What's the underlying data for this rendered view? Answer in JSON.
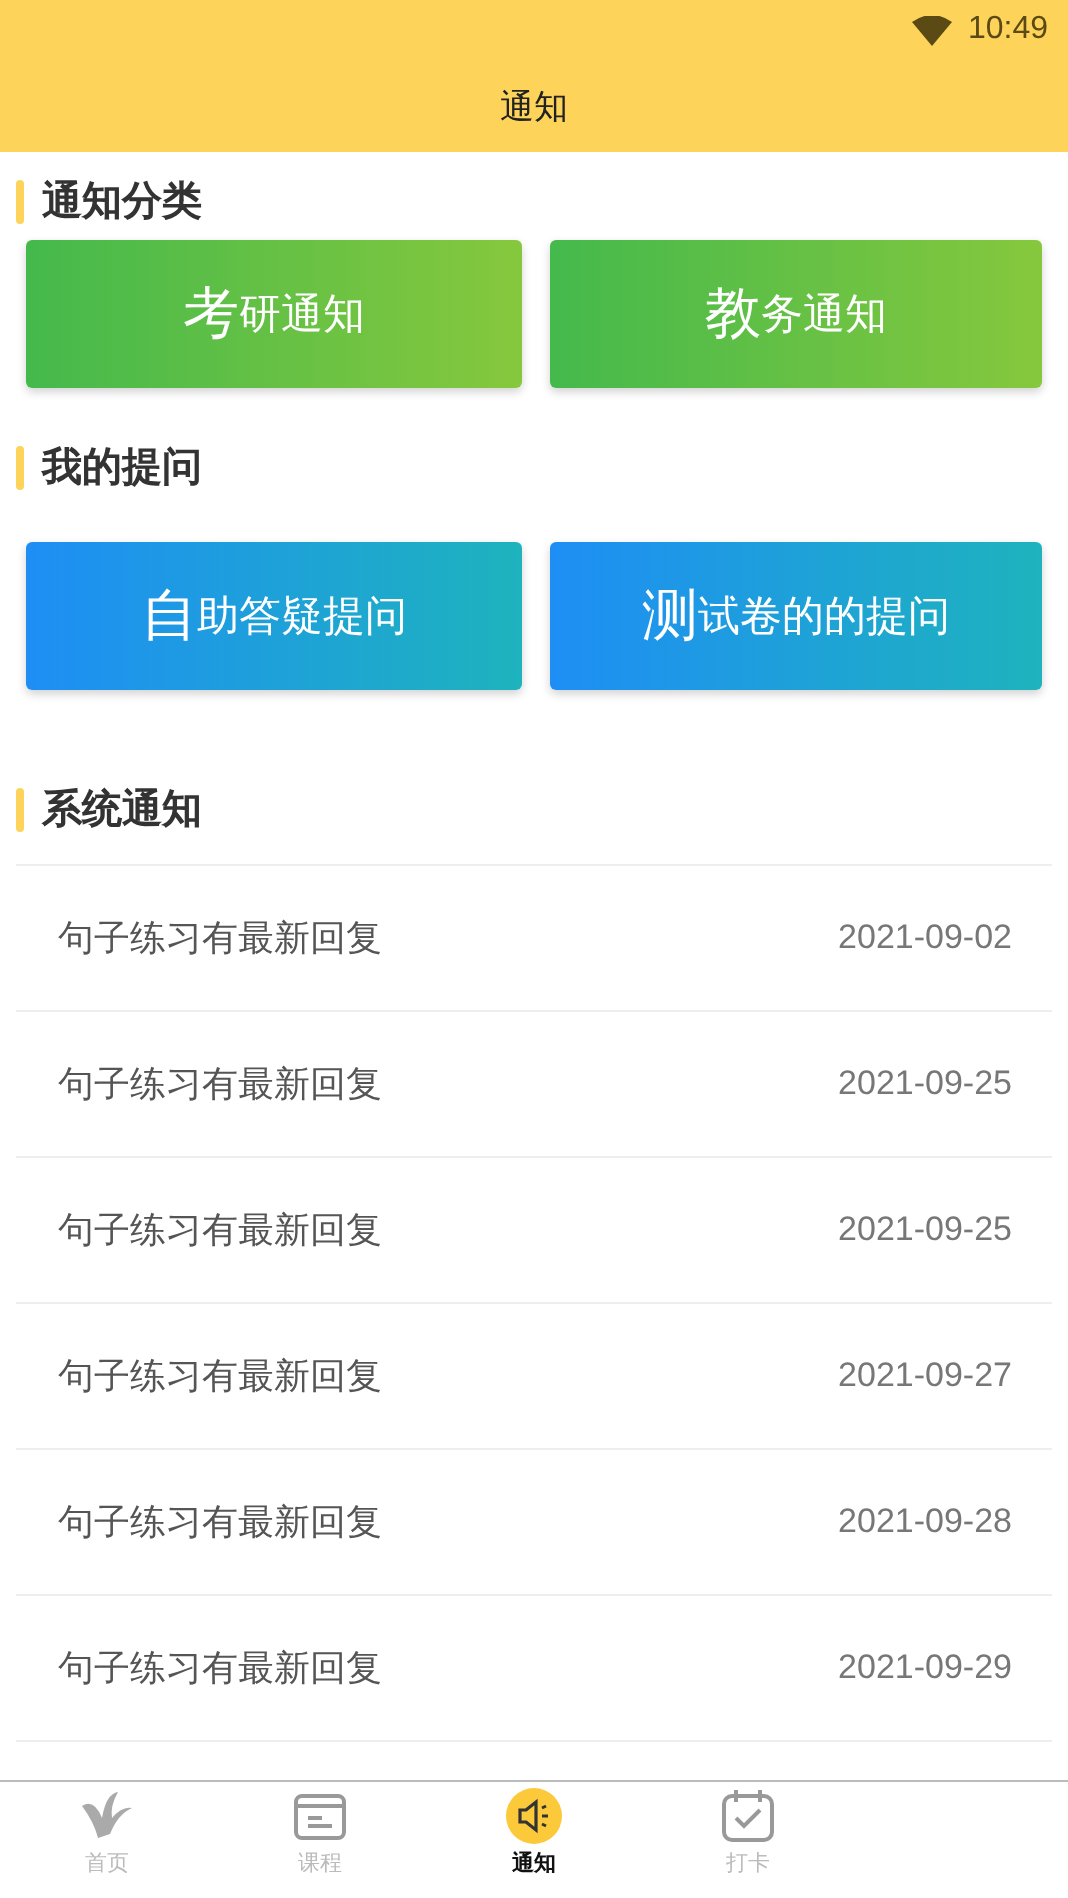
{
  "status_bar": {
    "time": "10:49"
  },
  "title": "通知",
  "sections": [
    {
      "heading": "通知分类",
      "buttons": [
        {
          "lead": "考",
          "rest": "研通知"
        },
        {
          "lead": "教",
          "rest": "务通知"
        }
      ]
    },
    {
      "heading": "我的提问",
      "buttons": [
        {
          "lead": "自",
          "rest": "助答疑提问"
        },
        {
          "lead": "测",
          "rest": "试卷的的提问"
        }
      ]
    }
  ],
  "system": {
    "heading": "系统通知",
    "items": [
      {
        "text": "句子练习有最新回复",
        "date": "2021-09-02"
      },
      {
        "text": "句子练习有最新回复",
        "date": "2021-09-25"
      },
      {
        "text": "句子练习有最新回复",
        "date": "2021-09-25"
      },
      {
        "text": "句子练习有最新回复",
        "date": "2021-09-27"
      },
      {
        "text": "句子练习有最新回复",
        "date": "2021-09-28"
      },
      {
        "text": "句子练习有最新回复",
        "date": "2021-09-29"
      }
    ]
  },
  "tabs": [
    {
      "label": "首页",
      "selected": false
    },
    {
      "label": "课程",
      "selected": false
    },
    {
      "label": "通知",
      "selected": true
    },
    {
      "label": "打卡",
      "selected": false
    }
  ]
}
